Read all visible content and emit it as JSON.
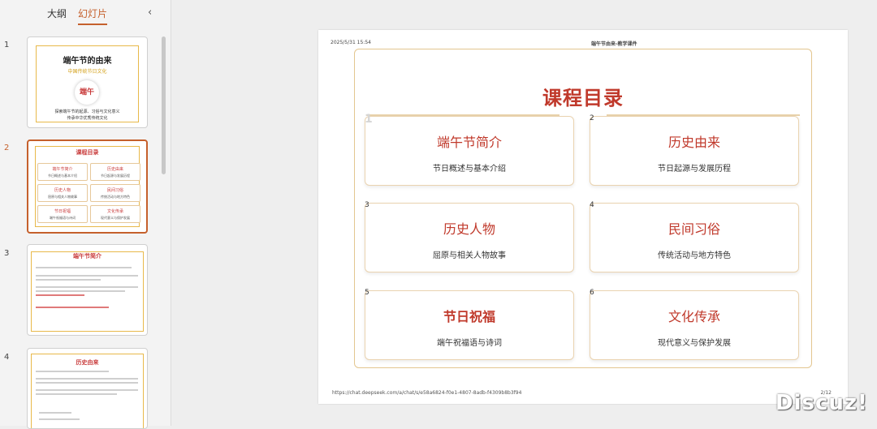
{
  "tabs": [
    "大纲",
    "幻灯片"
  ],
  "collapse_icon": "chevron-left-icon",
  "thumbnails": [
    {
      "num": "1",
      "title": "端午节的由来",
      "subtitle": "中国传统节日文化",
      "circle": "端午",
      "desc1": "探索端午节的起源、习俗与文化意义",
      "desc2": "传承中华优秀传统文化"
    },
    {
      "num": "2",
      "title": "课程目录",
      "cards": [
        {
          "a": "端午节简介",
          "b": "节日概述与基本介绍"
        },
        {
          "a": "历史由来",
          "b": "节日起源与发展历程"
        },
        {
          "a": "历史人物",
          "b": "屈原与相关人物故事"
        },
        {
          "a": "民间习俗",
          "b": "传统活动与地方特色"
        },
        {
          "a": "节日祝福",
          "b": "端午祝福语与诗词"
        },
        {
          "a": "文化传承",
          "b": "现代意义与保护发展"
        }
      ]
    },
    {
      "num": "3",
      "title": "端午节简介"
    },
    {
      "num": "4",
      "title": "历史由来"
    }
  ],
  "slide": {
    "header_left": "2025/5/31 15:54",
    "header_center": "端午节由来-教学课件",
    "title": "课程目录",
    "cards": [
      {
        "num": "1",
        "title": "端午节简介",
        "desc": "节日概述与基本介绍"
      },
      {
        "num": "2",
        "title": "历史由来",
        "desc": "节日起源与发展历程"
      },
      {
        "num": "3",
        "title": "历史人物",
        "desc": "屈原与相关人物故事"
      },
      {
        "num": "4",
        "title": "民间习俗",
        "desc": "传统活动与地方特色"
      },
      {
        "num": "5",
        "title": "节日祝福",
        "desc": "端午祝福语与诗词"
      },
      {
        "num": "6",
        "title": "文化传承",
        "desc": "现代意义与保护发展"
      }
    ],
    "footer_url": "https://chat.deepseek.com/a/chat/s/e58a6824-f0e1-4807-8adb-f4309b8b3f94",
    "footer_page": "2/12"
  },
  "watermark": "Discuz!",
  "colors": {
    "accent": "#c5602c",
    "title_red": "#c0392b",
    "gold": "#e3c68f"
  }
}
